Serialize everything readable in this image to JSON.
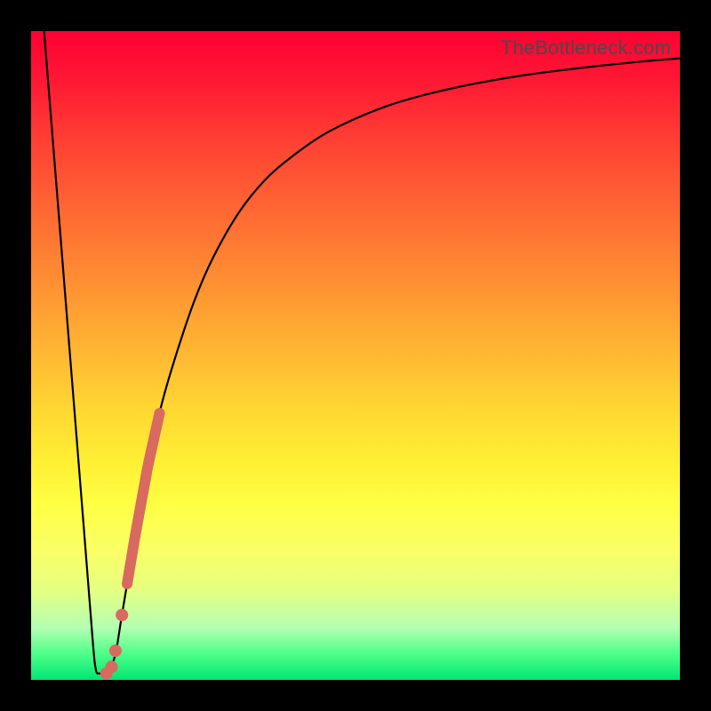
{
  "watermark": "TheBottleneck.com",
  "colors": {
    "curve_stroke": "#000000",
    "highlight_fill": "#d86a5f",
    "highlight_stroke": "#d86a5f"
  },
  "chart_data": {
    "type": "line",
    "title": "",
    "xlabel": "",
    "ylabel": "",
    "xlim": [
      0,
      100
    ],
    "ylim": [
      0,
      100
    ],
    "grid": false,
    "legend": false,
    "series": [
      {
        "name": "curve",
        "x": [
          2,
          4,
          6,
          8,
          9.5,
          10,
          10.5,
          11,
          12,
          13,
          14,
          16,
          18,
          20,
          22,
          25,
          28,
          32,
          36,
          40,
          45,
          50,
          55,
          60,
          65,
          70,
          76,
          82,
          88,
          94,
          100
        ],
        "y": [
          100,
          75,
          50,
          25,
          6,
          1.5,
          1,
          1,
          1.5,
          4,
          10,
          22,
          33,
          42,
          49,
          58,
          65,
          72,
          77,
          80.5,
          84,
          86.5,
          88.5,
          90,
          91.2,
          92.2,
          93.2,
          94,
          94.7,
          95.3,
          95.8
        ]
      }
    ],
    "highlight_band": {
      "from_x": 14.8,
      "to_x": 19.8,
      "thickness_px": 12
    },
    "highlight_points": [
      {
        "x": 14.0,
        "y": 10.0,
        "r": 7
      },
      {
        "x": 13.0,
        "y": 4.5,
        "r": 7
      },
      {
        "x": 12.4,
        "y": 2.0,
        "r": 7
      },
      {
        "x": 11.6,
        "y": 1.0,
        "r": 7
      }
    ]
  }
}
